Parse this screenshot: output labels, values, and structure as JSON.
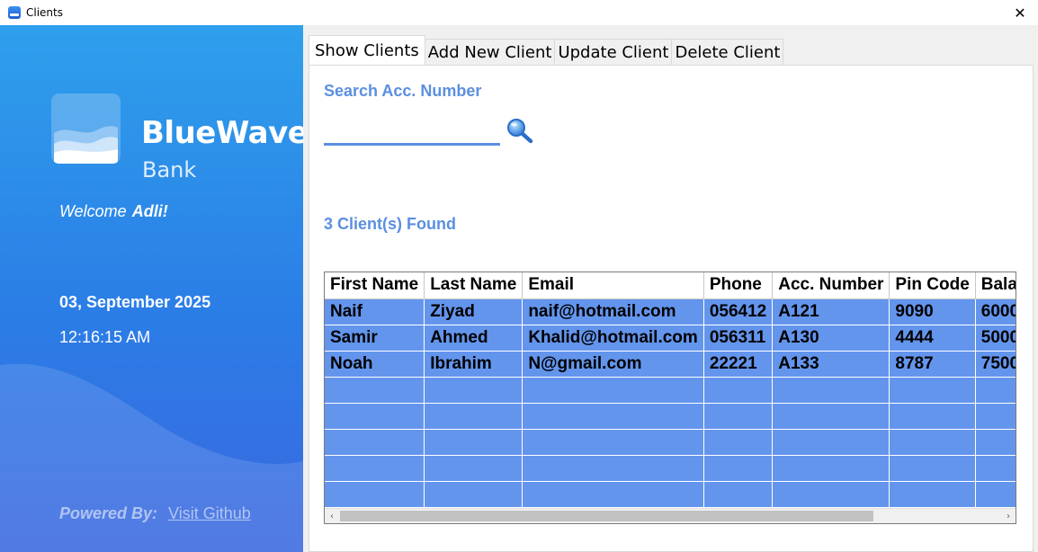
{
  "window": {
    "title": "Clients",
    "close_glyph": "✕"
  },
  "sidebar": {
    "brand_name": "BlueWave",
    "brand_sub": "Bank",
    "welcome_text": "Welcome",
    "user_name": "Adli!",
    "date": "03, September 2025",
    "time": "12:16:15 AM",
    "powered_label": "Powered By:",
    "github_link": "Visit Github",
    "colors": {
      "top": "#2ea0ec",
      "bottom": "#3b68e0"
    }
  },
  "tabs": [
    {
      "label": "Show Clients",
      "active": true
    },
    {
      "label": "Add New Client",
      "active": false
    },
    {
      "label": "Update Client",
      "active": false
    },
    {
      "label": "Delete Client",
      "active": false
    }
  ],
  "search": {
    "label": "Search Acc. Number",
    "value": "",
    "icon": "magnifier-icon"
  },
  "results": {
    "found_label": "3 Client(s) Found"
  },
  "grid": {
    "columns": [
      "First Name",
      "Last Name",
      "Email",
      "Phone",
      "Acc. Number",
      "Pin Code",
      "Balance"
    ],
    "rows": [
      [
        "Naif",
        "Ziyad",
        "naif@hotmail.com",
        "056412",
        "A121",
        "9090",
        "6000"
      ],
      [
        "Samir",
        "Ahmed",
        "Khalid@hotmail.com",
        "056311",
        "A130",
        "4444",
        "5000"
      ],
      [
        "Noah",
        "Ibrahim",
        "N@gmail.com",
        "22221",
        "A133",
        "8787",
        "7500"
      ],
      [
        "",
        "",
        "",
        "",
        "",
        "",
        ""
      ],
      [
        "",
        "",
        "",
        "",
        "",
        "",
        ""
      ],
      [
        "",
        "",
        "",
        "",
        "",
        "",
        ""
      ],
      [
        "",
        "",
        "",
        "",
        "",
        "",
        ""
      ],
      [
        "",
        "",
        "",
        "",
        "",
        "",
        ""
      ]
    ],
    "row_color": "#6495ed",
    "scroll_left_glyph": "‹",
    "scroll_right_glyph": "›"
  }
}
